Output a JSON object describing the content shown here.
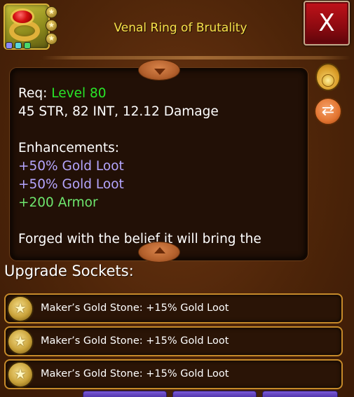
{
  "item": {
    "name": "Venal Ring of Brutality",
    "icon": "red-gem-ring-icon",
    "socket_star_icon": "star-socket-icon",
    "rarity_dots": [
      "#8a8aff",
      "#5ad8d8",
      "#4ad86a"
    ]
  },
  "header": {
    "close_label": "X",
    "close_color": "#a80e16"
  },
  "description": {
    "req_prefix": "Req:",
    "req_level": "Level 80",
    "stats": "45 STR, 82 INT, 12.12 Damage",
    "enhancements_heading": "Enhancements:",
    "enhancements": [
      "+50% Gold Loot",
      "+50% Gold Loot",
      "+200 Armor"
    ],
    "flavor_text": "Forged with the belief it will bring the",
    "colors": {
      "level": "#28e628",
      "gold_loot": "#b5a6ff",
      "armor": "#6ee66e"
    }
  },
  "side_actions": {
    "gold_icon": "gold-bag-icon",
    "swap_icon": "swap-arrows-icon"
  },
  "sockets": {
    "heading": "Upgrade Sockets:",
    "items": [
      {
        "label": "Maker’s Gold Stone: +15% Gold Loot",
        "icon": "gold-star-gem-icon"
      },
      {
        "label": "Maker’s Gold Stone: +15% Gold Loot",
        "icon": "gold-star-gem-icon"
      },
      {
        "label": "Maker’s Gold Stone: +15% Gold Loot",
        "icon": "gold-star-gem-icon"
      }
    ]
  }
}
